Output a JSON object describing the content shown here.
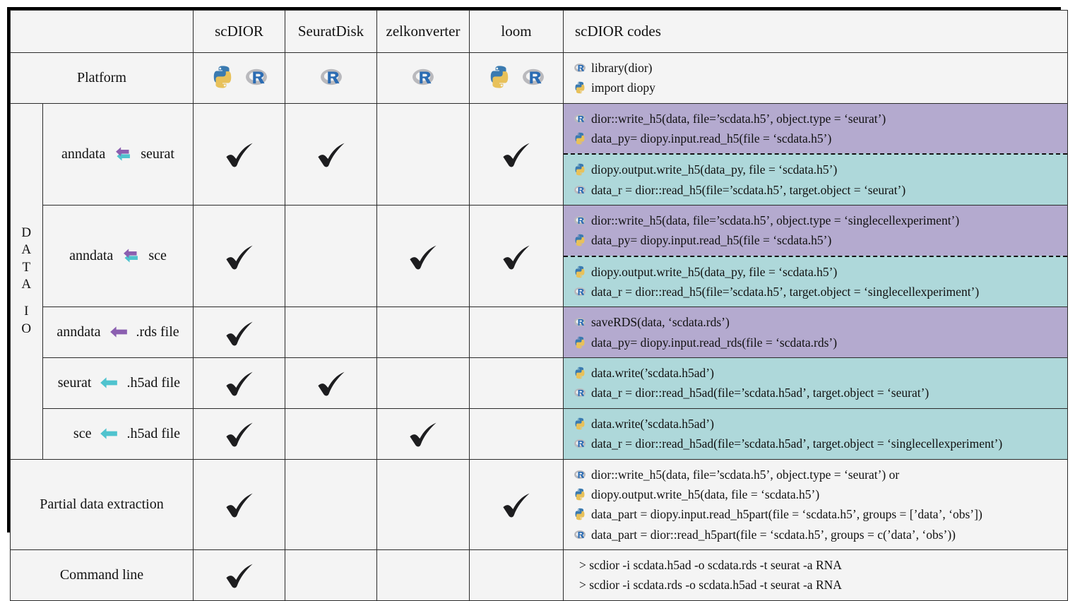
{
  "colors": {
    "purple": "#b4aacf",
    "teal": "#aed8da",
    "cell_bg": "#f4f4f4",
    "border": "#2b2b2b",
    "arrow_purple": "#8b5fb0",
    "arrow_teal": "#4fc3ce"
  },
  "header": {
    "corner": "",
    "columns": [
      "scDIOR",
      "SeuratDisk",
      "zelkonverter",
      "loom"
    ],
    "codes_label": "scDIOR codes"
  },
  "rotated_label": {
    "top": [
      "D",
      "A",
      "T",
      "A"
    ],
    "bottom": [
      "I",
      "O"
    ]
  },
  "rows": {
    "platform": {
      "label": "Platform",
      "support": [
        {
          "icons": [
            "python-icon",
            "r-icon"
          ]
        },
        {
          "icons": [
            "r-icon"
          ]
        },
        {
          "icons": [
            "r-icon"
          ]
        },
        {
          "icons": [
            "python-icon",
            "r-icon"
          ]
        }
      ],
      "code": {
        "style": "plain",
        "lines": [
          {
            "icon": "r-icon",
            "text": "library(dior)"
          },
          {
            "icon": "python-icon",
            "text": "import diopy"
          }
        ]
      }
    },
    "anndata_seurat": {
      "label_left": "anndata",
      "arrow": "double-arrow-icon",
      "label_right": "seurat",
      "checks": [
        true,
        true,
        false,
        true
      ],
      "code_purple": [
        {
          "icon": "r-icon",
          "text": "dior::write_h5(data, file=’scdata.h5’, object.type = ‘seurat’)"
        },
        {
          "icon": "python-icon",
          "text": "data_py= diopy.input.read_h5(file = ‘scdata.h5’)"
        }
      ],
      "code_teal": [
        {
          "icon": "python-icon",
          "text": "diopy.output.write_h5(data_py, file = ‘scdata.h5’)"
        },
        {
          "icon": "r-icon",
          "text": "data_r = dior::read_h5(file=’scdata.h5’, target.object = ‘seurat’)"
        }
      ]
    },
    "anndata_sce": {
      "label_left": "anndata",
      "arrow": "double-arrow-icon",
      "label_right": "sce",
      "checks": [
        true,
        false,
        true,
        true
      ],
      "code_purple": [
        {
          "icon": "r-icon",
          "text": "dior::write_h5(data, file=’scdata.h5’, object.type = ‘singlecellexperiment’)"
        },
        {
          "icon": "python-icon",
          "text": "data_py= diopy.input.read_h5(file = ‘scdata.h5’)"
        }
      ],
      "code_teal": [
        {
          "icon": "python-icon",
          "text": "diopy.output.write_h5(data_py, file = ‘scdata.h5’)"
        },
        {
          "icon": "r-icon",
          "text": "data_r = dior::read_h5(file=’scdata.h5’, target.object = ‘singlecellexperiment’)"
        }
      ]
    },
    "anndata_rds": {
      "label_left": "anndata",
      "arrow": "purple-arrow-icon",
      "label_right": ".rds file",
      "checks": [
        true,
        false,
        false,
        false
      ],
      "code_purple": [
        {
          "icon": "r-icon",
          "text": "saveRDS(data, ‘scdata.rds’)"
        },
        {
          "icon": "python-icon",
          "text": "data_py= diopy.input.read_rds(file = ‘scdata.rds’)"
        }
      ]
    },
    "seurat_h5ad": {
      "label_left": "seurat",
      "arrow": "teal-arrow-icon",
      "label_right": ".h5ad file",
      "checks": [
        true,
        true,
        false,
        false
      ],
      "code_teal": [
        {
          "icon": "python-icon",
          "text": "data.write(’scdata.h5ad’)"
        },
        {
          "icon": "r-icon",
          "text": "data_r = dior::read_h5ad(file=’scdata.h5ad’, target.object = ‘seurat’)"
        }
      ]
    },
    "sce_h5ad": {
      "label_left": "sce",
      "arrow": "teal-arrow-icon",
      "label_right": ".h5ad file",
      "checks": [
        true,
        false,
        true,
        false
      ],
      "code_teal": [
        {
          "icon": "python-icon",
          "text": "data.write(’scdata.h5ad’)"
        },
        {
          "icon": "r-icon",
          "text": "data_r = dior::read_h5ad(file=’scdata.h5ad’, target.object = ‘singlecellexperiment’)"
        }
      ]
    },
    "partial": {
      "label": "Partial data extraction",
      "checks": [
        true,
        false,
        false,
        true
      ],
      "code": [
        {
          "icon": "r-icon",
          "text": "dior::write_h5(data, file=’scdata.h5’, object.type = ‘seurat’) or"
        },
        {
          "icon": "python-icon",
          "text": "diopy.output.write_h5(data, file = ‘scdata.h5’)"
        },
        {
          "icon": "python-icon",
          "text": "data_part = diopy.input.read_h5part(file = ‘scdata.h5’, groups = [’data’, ‘obs’])"
        },
        {
          "icon": "r-icon",
          "text": "data_part = dior::read_h5part(file = ‘scdata.h5’, groups = c(’data’, ‘obs’))"
        }
      ]
    },
    "commandline": {
      "label": "Command line",
      "checks": [
        true,
        false,
        false,
        false
      ],
      "code": [
        {
          "icon": "none",
          "text": ">  scdior -i scdata.h5ad -o scdata.rds -t seurat -a RNA"
        },
        {
          "icon": "none",
          "text": ">  scdior -i scdata.rds -o scdata.h5ad -t seurat -a RNA"
        }
      ]
    }
  }
}
